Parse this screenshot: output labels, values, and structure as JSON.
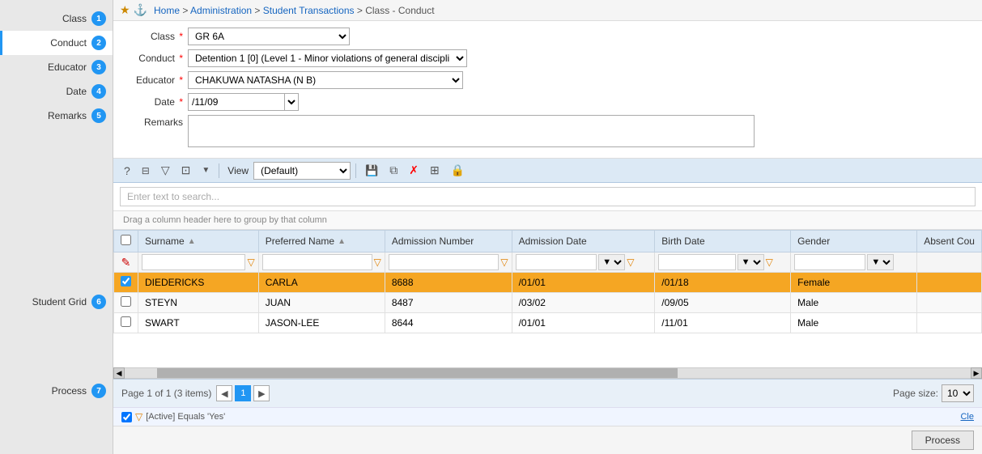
{
  "sidebar": {
    "items": [
      {
        "id": "class",
        "label": "Class",
        "badge": "1",
        "active": false
      },
      {
        "id": "conduct",
        "label": "Conduct",
        "badge": "2",
        "active": true
      },
      {
        "id": "educator",
        "label": "Educator",
        "badge": "3",
        "active": false
      },
      {
        "id": "date",
        "label": "Date",
        "badge": "4",
        "active": false
      },
      {
        "id": "remarks",
        "label": "Remarks",
        "badge": "5",
        "active": false
      }
    ]
  },
  "breadcrumb": {
    "home": "Home",
    "sep1": " > ",
    "admin": "Administration",
    "sep2": " > ",
    "student_tx": "Student Transactions",
    "sep3": " > ",
    "current": "Class - Conduct"
  },
  "form": {
    "class_label": "Class",
    "class_value": "GR 6A",
    "conduct_label": "Conduct",
    "conduct_value": "Detention 1 [0] (Level 1 - Minor violations of general discipli",
    "educator_label": "Educator",
    "educator_value": "CHAKUWA NATASHA (N B)",
    "date_label": "Date",
    "date_value": "/11/09",
    "remarks_label": "Remarks",
    "required_marker": "*"
  },
  "toolbar": {
    "view_label": "View",
    "view_value": "(Default)",
    "buttons": [
      {
        "id": "help",
        "icon": "?",
        "title": "Help"
      },
      {
        "id": "grid",
        "icon": "⊞",
        "title": "Grid"
      },
      {
        "id": "filter",
        "icon": "▽",
        "title": "Filter"
      },
      {
        "id": "columns",
        "icon": "⊟",
        "title": "Columns"
      },
      {
        "id": "dropdown",
        "icon": "▼",
        "title": "More"
      },
      {
        "id": "save",
        "icon": "💾",
        "title": "Save"
      },
      {
        "id": "copy",
        "icon": "⧉",
        "title": "Copy"
      },
      {
        "id": "delete",
        "icon": "✗",
        "title": "Delete"
      },
      {
        "id": "detail",
        "icon": "⊞",
        "title": "Detail"
      },
      {
        "id": "lock",
        "icon": "🔒",
        "title": "Lock"
      }
    ]
  },
  "search": {
    "placeholder": "Enter text to search..."
  },
  "grid": {
    "drag_hint": "Drag a column header here to group by that column",
    "columns": [
      {
        "id": "checkbox",
        "label": ""
      },
      {
        "id": "surname",
        "label": "Surname"
      },
      {
        "id": "preferred_name",
        "label": "Preferred Name"
      },
      {
        "id": "admission_number",
        "label": "Admission Number"
      },
      {
        "id": "admission_date",
        "label": "Admission Date"
      },
      {
        "id": "birth_date",
        "label": "Birth Date"
      },
      {
        "id": "gender",
        "label": "Gender"
      },
      {
        "id": "absent_count",
        "label": "Absent Cou"
      }
    ],
    "rows": [
      {
        "selected": true,
        "surname": "DIEDERICKS",
        "preferred_name": "CARLA",
        "admission_number": "8688",
        "admission_date": "/01/01",
        "birth_date": "/01/18",
        "gender": "Female",
        "absent_count": ""
      },
      {
        "selected": false,
        "surname": "STEYN",
        "preferred_name": "JUAN",
        "admission_number": "8487",
        "admission_date": "/03/02",
        "birth_date": "/09/05",
        "gender": "Male",
        "absent_count": ""
      },
      {
        "selected": false,
        "surname": "SWART",
        "preferred_name": "JASON-LEE",
        "admission_number": "8644",
        "admission_date": "/01/01",
        "birth_date": "/11/01",
        "gender": "Male",
        "absent_count": ""
      }
    ]
  },
  "pagination": {
    "info": "Page 1 of 1 (3 items)",
    "current_page": "1",
    "page_size_label": "Page size:",
    "page_size_value": "10"
  },
  "filter_bar": {
    "active_filter": "[Active] Equals 'Yes'",
    "clear_label": "Cle"
  },
  "process_bar": {
    "label": "Process",
    "badge": "7",
    "process_btn": "Process"
  },
  "student_grid_label": "Student Grid",
  "student_grid_badge": "6"
}
